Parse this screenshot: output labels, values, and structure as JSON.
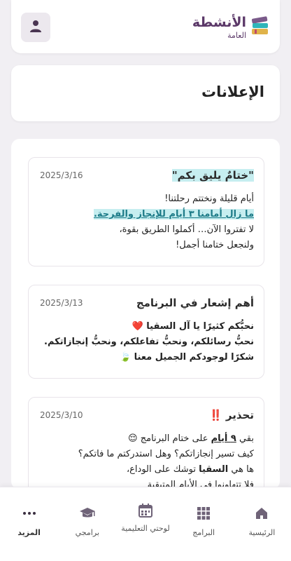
{
  "header": {
    "logo_main": "الأنشطة",
    "logo_sub": "العامة",
    "avatar_icon": "user-icon"
  },
  "page": {
    "title": "الإعلانات"
  },
  "announcements": [
    {
      "title": "\"ختامٌ يليق بكم\"",
      "date": "2025/3/16",
      "line1": "أيام قليلة ونختتم رحلتنا!",
      "line2": "ما زال أمامنا ٣ أيام للإنجاز والفرحة.",
      "line3": "لا تفتروا الآن… أكملوا الطريق بقوة،",
      "line4": "ولنجعل ختامنا أجمل!"
    },
    {
      "title": "أهم إشعار في البرنامج",
      "date": "2025/3/13",
      "line1": "نحبُّكم كثيرًا يا آل السقيا ❤️",
      "line2": "نحبُّ رسائلكم، ونحبُّ تفاعلكم، ونحبُّ إنجازاتكم.",
      "line3": "شكرًا لوجودكم الجميل معنا 🍃"
    },
    {
      "title": "تحذير",
      "title_mark": "‼️",
      "date": "2025/3/10",
      "line1_pre": "بقي ",
      "line1_bold": "٩ أيام",
      "line1_post": " على ختام البرنامج 😌",
      "line2": "كيف تسير إنجازاتكم؟ وهل استدركتم ما فاتكم؟",
      "line3_pre": "ها هي ",
      "line3_bold": "السقيا",
      "line3_post": " توشك على الوداع،",
      "line4": "فلا تتهاونوا في الأيام المتبقية"
    }
  ],
  "bottom_nav": [
    {
      "label": "الرئيسية",
      "icon": "home-icon"
    },
    {
      "label": "البرامج",
      "icon": "grid-icon"
    },
    {
      "label": "لوحتي التعليمية",
      "icon": "calendar-icon"
    },
    {
      "label": "برامجي",
      "icon": "graduation-cap-icon"
    },
    {
      "label": "المزيد",
      "icon": "more-dots-icon"
    }
  ],
  "colors": {
    "brand": "#5b3868",
    "highlight": "#c6eef0",
    "link": "#1d7b88"
  }
}
